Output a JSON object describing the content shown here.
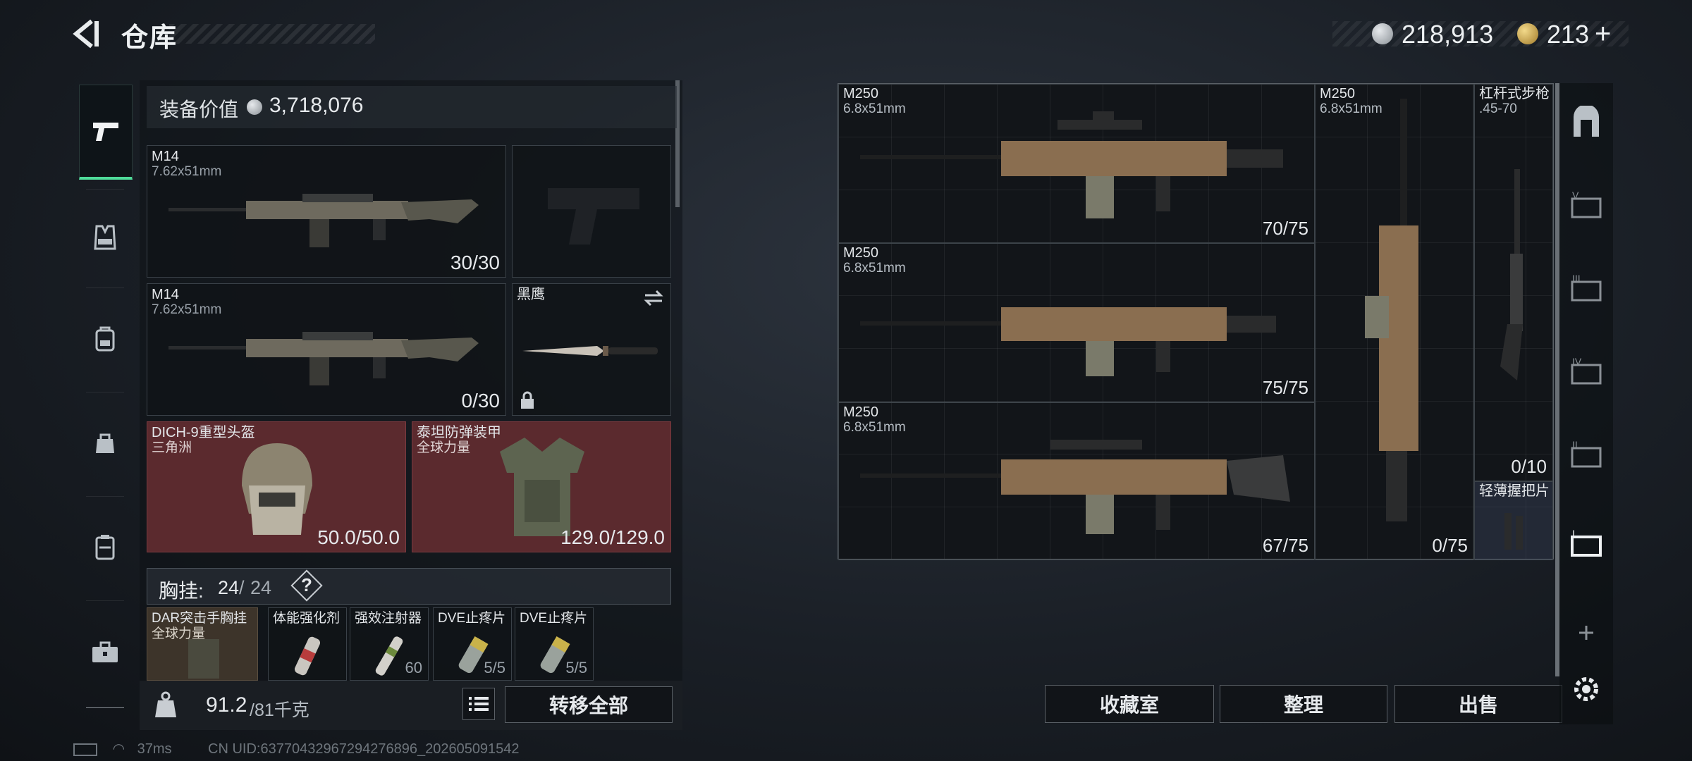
{
  "header": {
    "title": "仓库",
    "silver": "218,913",
    "gold": "213",
    "gold_plus": "+"
  },
  "icons": {
    "back": "back-arrow-icon",
    "silver": "silver-coin-icon",
    "gold": "gold-coin-icon",
    "nav": [
      "pistol-icon",
      "vest-icon",
      "backpack-icon",
      "small-bag-icon",
      "case-icon",
      "toolbox-icon"
    ],
    "right_nav": [
      "safe-room-icon",
      "storage-v-icon",
      "storage-iii-icon",
      "storage-iv-icon",
      "storage-ii-icon",
      "storage-i-icon",
      "add-icon",
      "settings-icon"
    ]
  },
  "equipment": {
    "label": "装备价值",
    "value": "3,718,076"
  },
  "loadout": [
    {
      "name": "M14",
      "caliber": "7.62x51mm",
      "count": "30/30"
    },
    {
      "name": "M14",
      "caliber": "7.62x51mm",
      "count": "0/30"
    },
    {
      "name": "黑鹰"
    },
    {
      "name": "DICH-9重型头盔",
      "sub": "三角洲",
      "count": "50.0/50.0"
    },
    {
      "name": "泰坦防弹装甲",
      "sub": "全球力量",
      "count": "129.0/129.0"
    }
  ],
  "chest": {
    "label": "胸挂:",
    "count": "24",
    "sep": "/",
    "max": "24",
    "help": "?"
  },
  "chest_items": [
    {
      "name": "DAR突击手胸挂",
      "sub": "全球力量"
    },
    {
      "name": "体能强化剂",
      "count": ""
    },
    {
      "name": "强效注射器",
      "count": "60"
    },
    {
      "name": "DVE止疼片",
      "count": "5/5"
    },
    {
      "name": "DVE止疼片",
      "count": "5/5"
    }
  ],
  "bottom": {
    "weight": "91.2",
    "weight_max": "/81千克",
    "transfer_all": "转移全部"
  },
  "storage": [
    {
      "name": "M250",
      "caliber": "6.8x51mm",
      "count": "70/75"
    },
    {
      "name": "M250",
      "caliber": "6.8x51mm",
      "count": "75/75"
    },
    {
      "name": "M250",
      "caliber": "6.8x51mm",
      "count": "67/75"
    },
    {
      "name": "M250",
      "caliber": "6.8x51mm",
      "count": "0/75"
    },
    {
      "name": "杠杆式步枪",
      "caliber": ".45-70",
      "count": "0/10"
    },
    {
      "name": "轻薄握把片"
    }
  ],
  "actions": {
    "collection": "收藏室",
    "organize": "整理",
    "sell": "出售"
  },
  "status": {
    "ping": "37ms",
    "uid": "CN UID:63770432967294276896_202605091542"
  },
  "colors": {
    "accent": "#4fdc9a",
    "red_slot": "#5b2a2e",
    "gold": "#d9b54a"
  }
}
